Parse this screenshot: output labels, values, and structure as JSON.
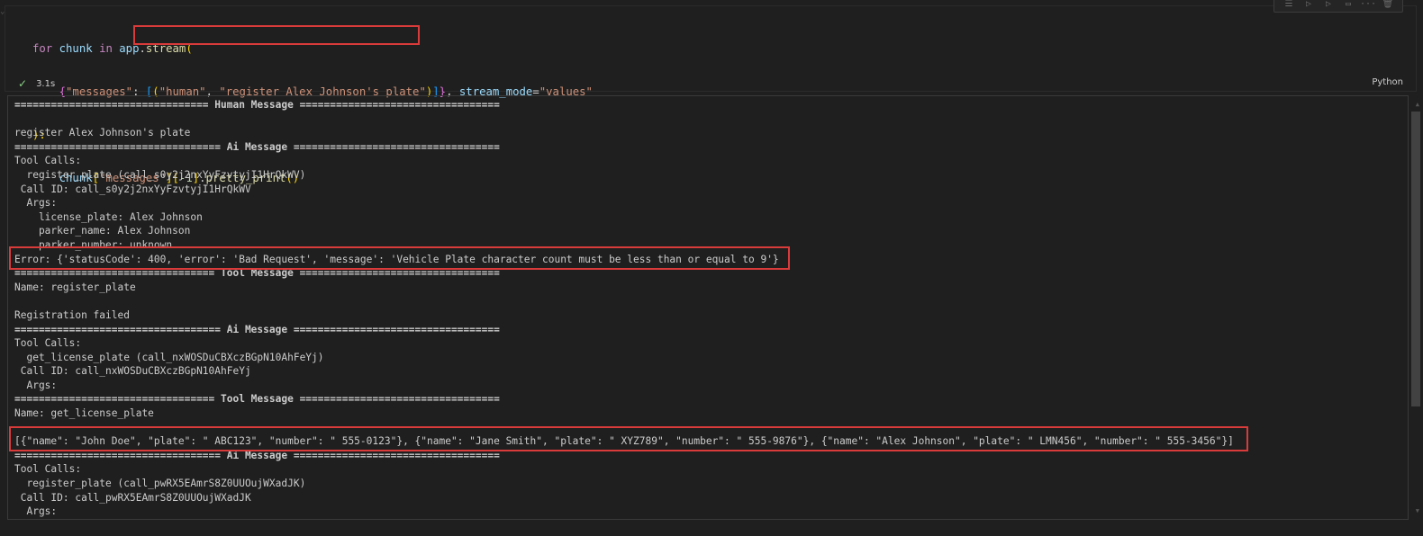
{
  "toolbar": {
    "icons": [
      "run-by-line-icon",
      "execute-above-icon",
      "execute-below-icon",
      "split-cell-icon",
      "more-icon",
      "delete-icon"
    ],
    "glyphs": [
      "☰",
      "▷",
      "▷",
      "▭",
      "···",
      "🗑"
    ]
  },
  "code": {
    "line1": {
      "kw": "for",
      "var1": "chunk",
      "kw2": "in",
      "obj": "app",
      "fn": "stream",
      "paren": "("
    },
    "line2": {
      "open": "{",
      "key": "\"messages\"",
      "colon": ": ",
      "bo": "[",
      "po": "(",
      "s1": "\"human\"",
      "comma": ", ",
      "s2": "\"register Alex Johnson's plate\"",
      "pc": ")",
      "bc": "]",
      "close": "}",
      "sep": ", ",
      "param": "stream_mode",
      "eq": "=",
      "val": "\"values\""
    },
    "line3": {
      "text": "):"
    },
    "line4": {
      "var": "chunk",
      "key": "\"messages\"",
      "idx": "-1",
      "fn": "pretty_print",
      "tail": "()"
    }
  },
  "status": {
    "time": "3.1s",
    "language": "Python"
  },
  "output": [
    {
      "text": "================================ Human Message =================================",
      "header": true
    },
    {
      "text": ""
    },
    {
      "text": "register Alex Johnson's plate"
    },
    {
      "text": "================================== Ai Message ==================================",
      "header": true
    },
    {
      "text": "Tool Calls:"
    },
    {
      "text": "  register_plate (call_s0y2j2nxYyFzvtyjI1HrQkWV)"
    },
    {
      "text": " Call ID: call_s0y2j2nxYyFzvtyjI1HrQkWV"
    },
    {
      "text": "  Args:"
    },
    {
      "text": "    license_plate: Alex Johnson"
    },
    {
      "text": "    parker_name: Alex Johnson"
    },
    {
      "text": "    parker_number: unknown"
    },
    {
      "text": "Error: {'statusCode': 400, 'error': 'Bad Request', 'message': 'Vehicle Plate character count must be less than or equal to 9'}"
    },
    {
      "text": "================================= Tool Message =================================",
      "header": true
    },
    {
      "text": "Name: register_plate"
    },
    {
      "text": ""
    },
    {
      "text": "Registration failed"
    },
    {
      "text": "================================== Ai Message ==================================",
      "header": true
    },
    {
      "text": "Tool Calls:"
    },
    {
      "text": "  get_license_plate (call_nxWOSDuCBXczBGpN10AhFeYj)"
    },
    {
      "text": " Call ID: call_nxWOSDuCBXczBGpN10AhFeYj"
    },
    {
      "text": "  Args:"
    },
    {
      "text": "================================= Tool Message =================================",
      "header": true
    },
    {
      "text": "Name: get_license_plate"
    },
    {
      "text": ""
    },
    {
      "text": "[{\"name\": \"John Doe\", \"plate\": \" ABC123\", \"number\": \" 555-0123\"}, {\"name\": \"Jane Smith\", \"plate\": \" XYZ789\", \"number\": \" 555-9876\"}, {\"name\": \"Alex Johnson\", \"plate\": \" LMN456\", \"number\": \" 555-3456\"}]"
    },
    {
      "text": "================================== Ai Message ==================================",
      "header": true
    },
    {
      "text": "Tool Calls:"
    },
    {
      "text": "  register_plate (call_pwRX5EAmrS8Z0UUOujWXadJK)"
    },
    {
      "text": " Call ID: call_pwRX5EAmrS8Z0UUOujWXadJK"
    },
    {
      "text": "  Args:"
    }
  ]
}
